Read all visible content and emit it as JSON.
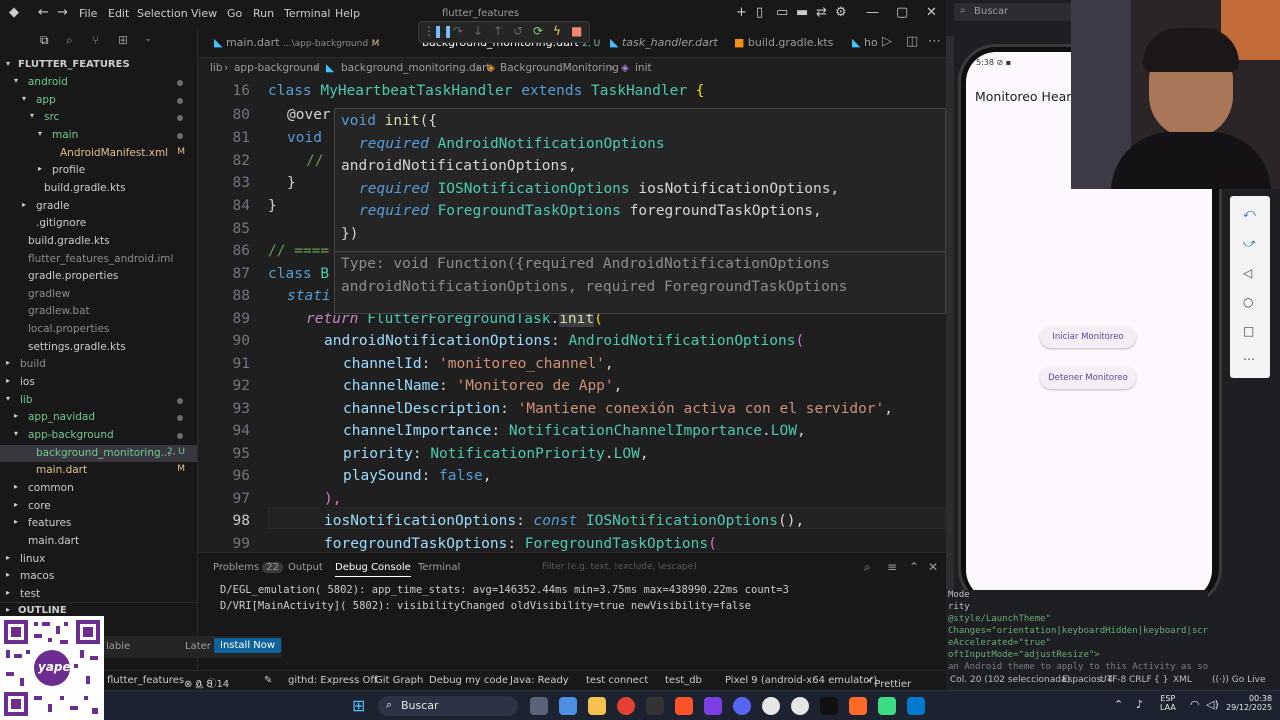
{
  "titlebar": {
    "menus": [
      "File",
      "Edit",
      "Selection",
      "View",
      "Go",
      "Run",
      "Terminal",
      "Help"
    ],
    "title": "flutter_features"
  },
  "tabs": [
    {
      "label": "main.dart",
      "path": "...\\app-background",
      "status": "M"
    },
    {
      "label": "background_monitoring.dart",
      "status": "2, U"
    },
    {
      "label": "task_handler.dart",
      "status": ""
    },
    {
      "label": "build.gradle.kts",
      "status": ""
    },
    {
      "label": "ho",
      "status": ""
    }
  ],
  "breadcrumb": [
    "lib",
    "app-background",
    "background_monitoring.dart",
    "BackgroundMonitoring",
    "init"
  ],
  "explorer": {
    "root": "FLUTTER_FEATURES",
    "items": [
      {
        "label": "android",
        "color": "#73c991"
      },
      {
        "label": "app",
        "color": "#73c991"
      },
      {
        "label": "src",
        "color": "#73c991"
      },
      {
        "label": "main",
        "color": "#73c991"
      },
      {
        "label": "AndroidManifest.xml",
        "status": "M",
        "color": "#e2c08d"
      },
      {
        "label": "profile",
        "color": "#cccccc"
      },
      {
        "label": "build.gradle.kts",
        "color": "#cccccc"
      },
      {
        "label": "gradle",
        "color": "#cccccc"
      },
      {
        "label": ".gitignore",
        "color": "#cccccc"
      },
      {
        "label": "build.gradle.kts",
        "color": "#cccccc"
      },
      {
        "label": "flutter_features_android.iml",
        "color": "#8c8c8c"
      },
      {
        "label": "gradle.properties",
        "color": "#cccccc"
      },
      {
        "label": "gradlew",
        "color": "#8c8c8c"
      },
      {
        "label": "gradlew.bat",
        "color": "#8c8c8c"
      },
      {
        "label": "local.properties",
        "color": "#8c8c8c"
      },
      {
        "label": "settings.gradle.kts",
        "color": "#cccccc"
      },
      {
        "label": "build",
        "color": "#8c8c8c"
      },
      {
        "label": "ios",
        "color": "#cccccc"
      },
      {
        "label": "lib",
        "color": "#73c991"
      },
      {
        "label": "app_navidad",
        "color": "#73c991"
      },
      {
        "label": "app-background",
        "color": "#73c991"
      },
      {
        "label": "background_monitoring...",
        "status": "2, U",
        "color": "#73c991"
      },
      {
        "label": "main.dart",
        "status": "M",
        "color": "#e2c08d"
      },
      {
        "label": "common",
        "color": "#cccccc"
      },
      {
        "label": "core",
        "color": "#cccccc"
      },
      {
        "label": "features",
        "color": "#cccccc"
      },
      {
        "label": "main.dart",
        "color": "#cccccc"
      },
      {
        "label": "linux",
        "color": "#cccccc"
      },
      {
        "label": "macos",
        "color": "#cccccc"
      },
      {
        "label": "test",
        "color": "#cccccc"
      }
    ],
    "outline": "OUTLINE"
  },
  "editor": {
    "line_numbers": [
      "16",
      "80",
      "81",
      "82",
      "83",
      "84",
      "85",
      "86",
      "87",
      "88",
      "89",
      "90",
      "91",
      "92",
      "93",
      "94",
      "95",
      "96",
      "97",
      "98",
      "99"
    ],
    "l16_kw": "class",
    "l16_name": "MyHeartbeatTaskHandler",
    "l16_ext": "extends",
    "l16_base": "TaskHandler",
    "l16_brace": "{",
    "l80": "@over",
    "l81": "void",
    "l82": "//",
    "l83": "}",
    "l84": "}",
    "l86": "// ====",
    "l87_kw": "class",
    "l87_rest": "B",
    "l88": "stati",
    "l89_ret": "return",
    "l89_cls": "FlutterForegroundTask",
    "l89_dot": ".",
    "l89_fn": "init",
    "l89_paren": "(",
    "l90_key": "androidNotificationOptions",
    "l90_colon": ":",
    "l90_cls": "AndroidNotificationOptions",
    "l90_paren": "(",
    "l91_key": "channelId",
    "l91_val": "'monitoreo_channel'",
    "l92_key": "channelName",
    "l92_val": "'Monitoreo de App'",
    "l93_key": "channelDescription",
    "l93_val": "'Mantiene conexión activa con el servidor'",
    "l94_key": "channelImportance",
    "l94_cls": "NotificationChannelImportance",
    "l94_val": "LOW",
    "l95_key": "priority",
    "l95_cls": "NotificationPriority",
    "l95_val": "LOW",
    "l96_key": "playSound",
    "l96_val": "false",
    "l97": "),",
    "l98_key": "iosNotificationOptions",
    "l98_kw": "const",
    "l98_cls": "IOSNotificationOptions",
    "l98_end": "(),",
    "l99_key": "foregroundTaskOptions",
    "l99_cls": "ForegroundTaskOptions",
    "l99_end": "("
  },
  "hover": {
    "h1_kw": "void",
    "h1_fn": "init",
    "h1_rest": "({",
    "h2_req": "required",
    "h2_ty": "AndroidNotificationOptions",
    "h3": "androidNotificationOptions,",
    "h4_req": "required",
    "h4_ty": "IOSNotificationOptions",
    "h4_name": "iosNotificationOptions,",
    "h5_req": "required",
    "h5_ty": "ForegroundTaskOptions",
    "h5_name": "foregroundTaskOptions,",
    "h6": "})",
    "h7": "Type: void Function({required AndroidNotificationOptions",
    "h8": "androidNotificationOptions, required ForegroundTaskOptions"
  },
  "panel": {
    "tabs": [
      "Problems",
      "Output",
      "Debug Console",
      "Terminal"
    ],
    "problems_count": "22",
    "filter_placeholder": "Filter (e.g. text, !exclude, \\escape)",
    "logs": [
      "D/EGL_emulation( 5802): app_time_stats: avg=146352.44ms min=3.75ms max=438990.22ms count=3",
      "D/VRI[MainActivity]( 5802): visibilityChanged oldVisibility=true newVisibility=false"
    ]
  },
  "toast": {
    "text": "lable",
    "later": "Later",
    "install": "Install Now"
  },
  "statusbar": {
    "project": "flutter_features",
    "errors": "0",
    "warnings": "8",
    "info": "14",
    "githd": "githd: Express Off",
    "gitgraph": "Git Graph",
    "debug": "Debug my code",
    "java": "Java: Ready",
    "testconnect": "test connect",
    "testdb": "test_db",
    "device": "Pixel 9 (android-x64 emulator)",
    "prettier": "Prettier"
  },
  "rightstatus": {
    "col": "Col. 20 (102 seleccionada)",
    "spaces": "Espacios: 4",
    "enc": "UTF-8",
    "eol": "CRLF",
    "braces": "{ }",
    "lang": "XML",
    "golive": "Go Live"
  },
  "search": {
    "placeholder": "Buscar"
  },
  "phone": {
    "time": "5:38",
    "app_title": "Monitoreo Heart",
    "start_button": "Iniciar Monitoreo",
    "stop_button": "Detener Monitoreo"
  },
  "manifest": [
    "Mode",
    "rity",
    "@style/LaunchTheme\"",
    "Changes=\"orientation|keyboardHidden|keyboard|screenS",
    "eAccelerated=\"true\"",
    "oftInputMode=\"adjustResize\">",
    "an Android theme to apply to this Activity as soon"
  ],
  "taskbar": {
    "search": "Buscar",
    "lang": "ESP",
    "region": "LAA",
    "time": "00:38",
    "date": "29/12/2025"
  },
  "qr": {
    "label": "yape"
  }
}
